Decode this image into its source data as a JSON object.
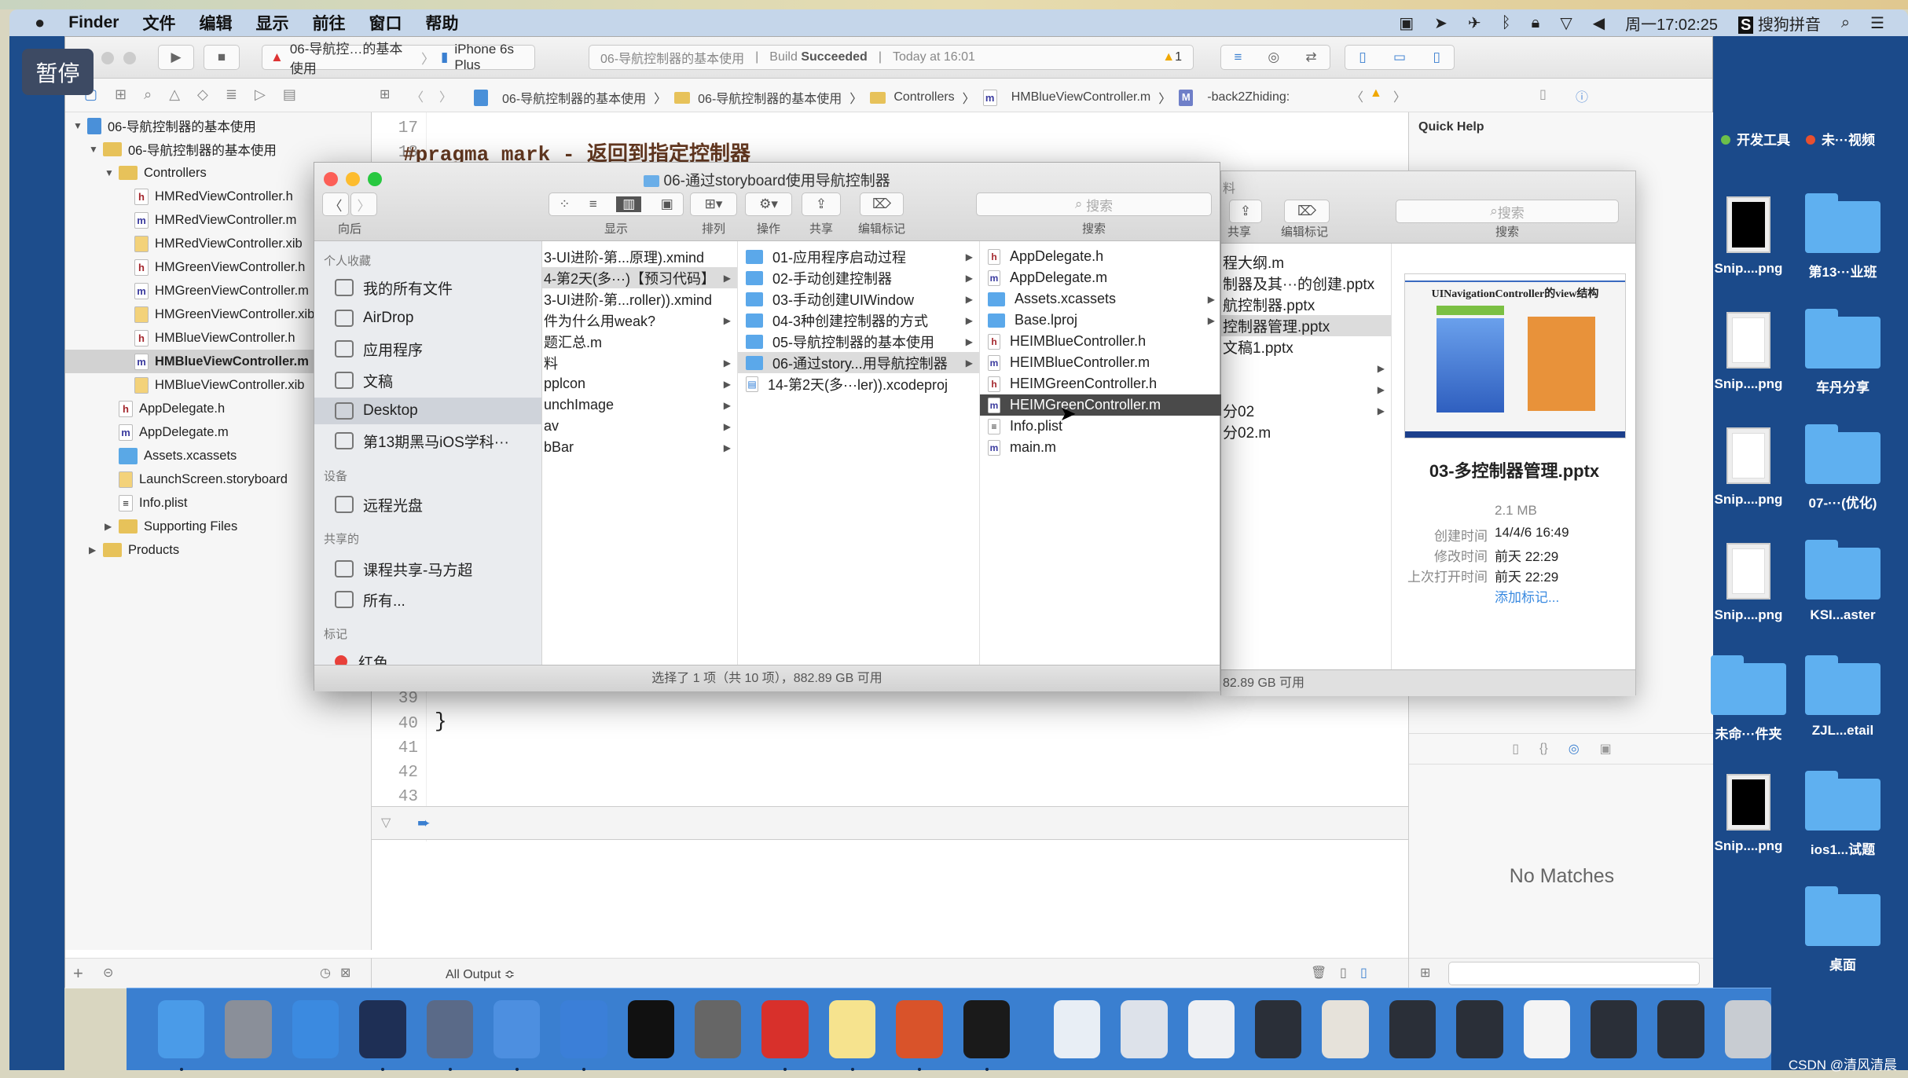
{
  "menubar": {
    "app": "Finder",
    "items": [
      "文件",
      "编辑",
      "显示",
      "前往",
      "窗口",
      "帮助"
    ],
    "clock": "周一17:02:25",
    "ime": "搜狗拼音"
  },
  "overlay": {
    "pause_label": "暂停"
  },
  "xcode": {
    "scheme": "06-导航控…的基本使用",
    "device": "iPhone 6s Plus",
    "activity": {
      "project": "06-导航控制器的基本使用",
      "status_prefix": "Build ",
      "status": "Succeeded",
      "time": "Today at 16:01",
      "warnings": "1"
    },
    "breadcrumbs": [
      "06-导航控制器的基本使用",
      "06-导航控制器的基本使用",
      "Controllers",
      "HMBlueViewController.m",
      "-back2Zhiding:"
    ],
    "navigator": [
      {
        "label": "06-导航控制器的基本使用",
        "depth": 0,
        "kind": "proj",
        "tri": "▼"
      },
      {
        "label": "06-导航控制器的基本使用",
        "depth": 1,
        "kind": "folder",
        "tri": "▼"
      },
      {
        "label": "Controllers",
        "depth": 2,
        "kind": "folder",
        "tri": "▼"
      },
      {
        "label": "HMRedViewController.h",
        "depth": 3,
        "kind": "h"
      },
      {
        "label": "HMRedViewController.m",
        "depth": 3,
        "kind": "m"
      },
      {
        "label": "HMRedViewController.xib",
        "depth": 3,
        "kind": "x"
      },
      {
        "label": "HMGreenViewController.h",
        "depth": 3,
        "kind": "h"
      },
      {
        "label": "HMGreenViewController.m",
        "depth": 3,
        "kind": "m"
      },
      {
        "label": "HMGreenViewController.xib",
        "depth": 3,
        "kind": "x"
      },
      {
        "label": "HMBlueViewController.h",
        "depth": 3,
        "kind": "h"
      },
      {
        "label": "HMBlueViewController.m",
        "depth": 3,
        "kind": "m",
        "selected": true
      },
      {
        "label": "HMBlueViewController.xib",
        "depth": 3,
        "kind": "x"
      },
      {
        "label": "AppDelegate.h",
        "depth": 2,
        "kind": "h"
      },
      {
        "label": "AppDelegate.m",
        "depth": 2,
        "kind": "m"
      },
      {
        "label": "Assets.xcassets",
        "depth": 2,
        "kind": "assets"
      },
      {
        "label": "LaunchScreen.storyboard",
        "depth": 2,
        "kind": "x"
      },
      {
        "label": "Info.plist",
        "depth": 2,
        "kind": "pl"
      },
      {
        "label": "Supporting Files",
        "depth": 2,
        "kind": "folder",
        "tri": "▶"
      },
      {
        "label": "Products",
        "depth": 1,
        "kind": "folder",
        "tri": "▶"
      }
    ],
    "code": {
      "top_lines": [
        "17",
        "18"
      ],
      "pragma": "#pragma mark - 返回到指定控制器",
      "bottom_lines": [
        "39",
        "40",
        "41",
        "42",
        "43"
      ],
      "brace": "}"
    },
    "debug": {
      "output_filter": "All Output ≎"
    },
    "utilities": {
      "quick_help": "Quick Help",
      "no_matches": "No Matches"
    }
  },
  "finder": {
    "title": "06-通过storyboard使用导航控制器",
    "toolbar": {
      "back": "向后",
      "view": "显示",
      "arrange": "排列",
      "action": "操作",
      "share": "共享",
      "tags": "编辑标记",
      "search_placeholder": "搜索",
      "search": "搜索"
    },
    "sidebar": [
      {
        "type": "header",
        "label": "个人收藏"
      },
      {
        "type": "item",
        "label": "我的所有文件",
        "icon": "all-files-icon"
      },
      {
        "type": "item",
        "label": "AirDrop",
        "icon": "airdrop-icon"
      },
      {
        "type": "item",
        "label": "应用程序",
        "icon": "applications-icon"
      },
      {
        "type": "item",
        "label": "文稿",
        "icon": "documents-icon"
      },
      {
        "type": "item",
        "label": "Desktop",
        "icon": "desktop-icon",
        "selected": true
      },
      {
        "type": "item",
        "label": "第13期黑马iOS学科···",
        "icon": "folder-icon"
      },
      {
        "type": "header",
        "label": "设备"
      },
      {
        "type": "item",
        "label": "远程光盘",
        "icon": "disc-icon"
      },
      {
        "type": "header",
        "label": "共享的"
      },
      {
        "type": "item",
        "label": "课程共享-马方超",
        "icon": "computer-icon"
      },
      {
        "type": "item",
        "label": "所有...",
        "icon": "network-icon"
      },
      {
        "type": "header",
        "label": "标记"
      },
      {
        "type": "item",
        "label": "红色",
        "icon": "red-tag-icon"
      }
    ],
    "col1": [
      {
        "label": "3-UI进阶-第...原理).xmind"
      },
      {
        "label": "4-第2天(多···)【预习代码】",
        "arrow": true,
        "selected": true
      },
      {
        "label": "3-UI进阶-第...roller)).xmind"
      },
      {
        "label": "件为什么用weak?",
        "arrow": true
      },
      {
        "label": "题汇总.m"
      },
      {
        "label": "料",
        "arrow": true
      },
      {
        "label": "pplcon",
        "arrow": true
      },
      {
        "label": "unchImage",
        "arrow": true
      },
      {
        "label": "av",
        "arrow": true
      },
      {
        "label": "bBar",
        "arrow": true
      }
    ],
    "col2": [
      {
        "label": "01-应用程序启动过程",
        "kind": "folder",
        "arrow": true
      },
      {
        "label": "02-手动创建控制器",
        "kind": "folder",
        "arrow": true
      },
      {
        "label": "03-手动创建UIWindow",
        "kind": "folder",
        "arrow": true
      },
      {
        "label": "04-3种创建控制器的方式",
        "kind": "folder",
        "arrow": true
      },
      {
        "label": "05-导航控制器的基本使用",
        "kind": "folder",
        "arrow": true
      },
      {
        "label": "06-通过story...用导航控制器",
        "kind": "folder",
        "arrow": true,
        "selected": true
      },
      {
        "label": "14-第2天(多···ler)).xcodeproj",
        "kind": "p"
      }
    ],
    "col3": [
      {
        "label": "AppDelegate.h",
        "kind": "h"
      },
      {
        "label": "AppDelegate.m",
        "kind": "m"
      },
      {
        "label": "Assets.xcassets",
        "kind": "folder",
        "arrow": true
      },
      {
        "label": "Base.lproj",
        "kind": "folder",
        "arrow": true
      },
      {
        "label": "HEIMBlueController.h",
        "kind": "h"
      },
      {
        "label": "HEIMBlueController.m",
        "kind": "m"
      },
      {
        "label": "HEIMGreenController.h",
        "kind": "h"
      },
      {
        "label": "HEIMGreenController.m",
        "kind": "m",
        "selected": true
      },
      {
        "label": "Info.plist",
        "kind": "pl"
      },
      {
        "label": "main.m",
        "kind": "m"
      }
    ],
    "status": "选择了 1 项（共 10 项），882.89 GB 可用"
  },
  "finder2": {
    "title_fragment": "料",
    "toolbar": {
      "share": "共享",
      "tags": "编辑标记",
      "search_placeholder": "搜索",
      "search": "搜索"
    },
    "files": [
      {
        "label": "程大纲.m"
      },
      {
        "label": "制器及其···的创建.pptx"
      },
      {
        "label": "航控制器.pptx"
      },
      {
        "label": "控制器管理.pptx",
        "selected": true
      },
      {
        "label": "文稿1.pptx"
      },
      {
        "label": "",
        "arrow": true
      },
      {
        "label": "",
        "arrow": true
      },
      {
        "label": "分02",
        "arrow": true
      },
      {
        "label": "分02.m"
      }
    ],
    "preview": {
      "slide_title": "UINavigationController的view结构",
      "name": "03-多控制器管理.pptx",
      "size": "2.1 MB",
      "info": [
        {
          "k": "创建时间",
          "v": "14/4/6 16:49"
        },
        {
          "k": "修改时间",
          "v": "前天 22:29"
        },
        {
          "k": "上次打开时间",
          "v": "前天 22:29"
        }
      ],
      "add_tags": "添加标记..."
    },
    "status": "82.89 GB 可用"
  },
  "desktop": {
    "tags": [
      "开发工具",
      "未···视频"
    ],
    "tag_colors": [
      "#6cc04a",
      "#e8502f"
    ],
    "icons": [
      {
        "label": "Snip....png",
        "kind": "thumb-dark"
      },
      {
        "label": "第13···业班",
        "kind": "folder"
      },
      {
        "label": "Snip....png",
        "kind": "thumb-light"
      },
      {
        "label": "车丹分享",
        "kind": "folder"
      },
      {
        "label": "Snip....png",
        "kind": "thumb-light"
      },
      {
        "label": "07-···(优化)",
        "kind": "folder"
      },
      {
        "label": "Snip....png",
        "kind": "thumb-light"
      },
      {
        "label": "KSI...aster",
        "kind": "folder"
      },
      {
        "label": "未命···件夹",
        "kind": "folder"
      },
      {
        "label": "ZJL...etail",
        "kind": "folder"
      },
      {
        "label": "Snip....png",
        "kind": "thumb-dark"
      },
      {
        "label": "ios1...试题",
        "kind": "folder"
      },
      {
        "label": "",
        "kind": "none"
      },
      {
        "label": "桌面",
        "kind": "folder"
      }
    ]
  },
  "dock": {
    "apps": [
      {
        "name": "finder-icon",
        "color": "#4a9be8",
        "active": true
      },
      {
        "name": "launchpad-icon",
        "color": "#8a8f99"
      },
      {
        "name": "safari-icon",
        "color": "#3b8ae0"
      },
      {
        "name": "mouse-app-icon",
        "color": "#1e2f55",
        "active": true
      },
      {
        "name": "photo-booth-icon",
        "color": "#5a6a88",
        "active": true
      },
      {
        "name": "xcode-icon",
        "color": "#4d8fe0",
        "active": true
      },
      {
        "name": "instruments-icon",
        "color": "#3b7fd8",
        "active": true
      },
      {
        "name": "terminal-icon",
        "color": "#111"
      },
      {
        "name": "system-preferences-icon",
        "color": "#666"
      },
      {
        "name": "xmind-icon",
        "color": "#d8302b",
        "active": true
      },
      {
        "name": "notes-icon",
        "color": "#f6e38e",
        "active": true
      },
      {
        "name": "powerpoint-icon",
        "color": "#d9532a",
        "active": true
      },
      {
        "name": "console-icon",
        "color": "#1a1a1a",
        "active": true
      },
      {
        "name": "window-thumb-icon",
        "color": "#e8eef5"
      },
      {
        "name": "window-thumb-icon",
        "color": "#dde2ea"
      },
      {
        "name": "window-thumb-icon",
        "color": "#eef0f3"
      },
      {
        "name": "window-thumb-icon",
        "color": "#2a2f38"
      },
      {
        "name": "window-thumb-icon",
        "color": "#e6e2da"
      },
      {
        "name": "window-thumb-icon",
        "color": "#2a2f38"
      },
      {
        "name": "window-thumb-icon",
        "color": "#2a2f38"
      },
      {
        "name": "window-thumb-icon",
        "color": "#f4f4f4"
      },
      {
        "name": "window-thumb-icon",
        "color": "#2a2f38"
      },
      {
        "name": "window-thumb-icon",
        "color": "#2a2f38"
      },
      {
        "name": "trash-icon",
        "color": "#c8ccd2"
      }
    ]
  },
  "watermark": "CSDN @清风清晨"
}
